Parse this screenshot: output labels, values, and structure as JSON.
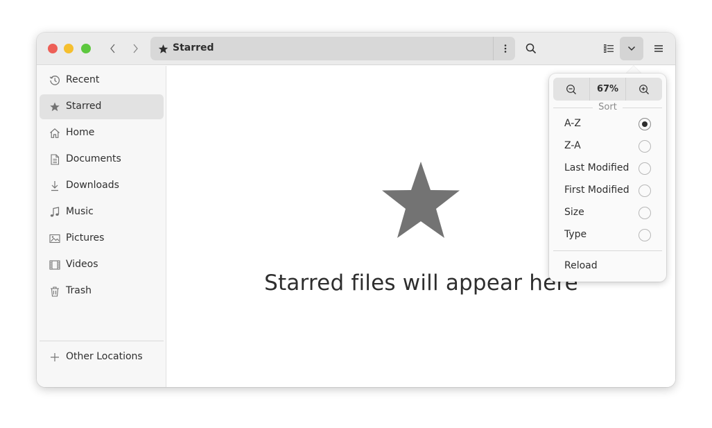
{
  "window": {
    "location_title": "Starred"
  },
  "sidebar": {
    "items": [
      {
        "label": "Recent"
      },
      {
        "label": "Starred"
      },
      {
        "label": "Home"
      },
      {
        "label": "Documents"
      },
      {
        "label": "Downloads"
      },
      {
        "label": "Music"
      },
      {
        "label": "Pictures"
      },
      {
        "label": "Videos"
      },
      {
        "label": "Trash"
      }
    ],
    "other_locations": "Other Locations"
  },
  "content": {
    "empty_message": "Starred files will appear here"
  },
  "view_popover": {
    "zoom_level": "67%",
    "sort_heading": "Sort",
    "sort_options": [
      {
        "label": "A-Z",
        "selected": true
      },
      {
        "label": "Z-A",
        "selected": false
      },
      {
        "label": "Last Modified",
        "selected": false
      },
      {
        "label": "First Modified",
        "selected": false
      },
      {
        "label": "Size",
        "selected": false
      },
      {
        "label": "Type",
        "selected": false
      }
    ],
    "reload_label": "Reload"
  },
  "colors": {
    "close": "#ed5f57",
    "minimize": "#f5bf2f",
    "maximize": "#5dc83e",
    "icon_gray": "#737373"
  }
}
